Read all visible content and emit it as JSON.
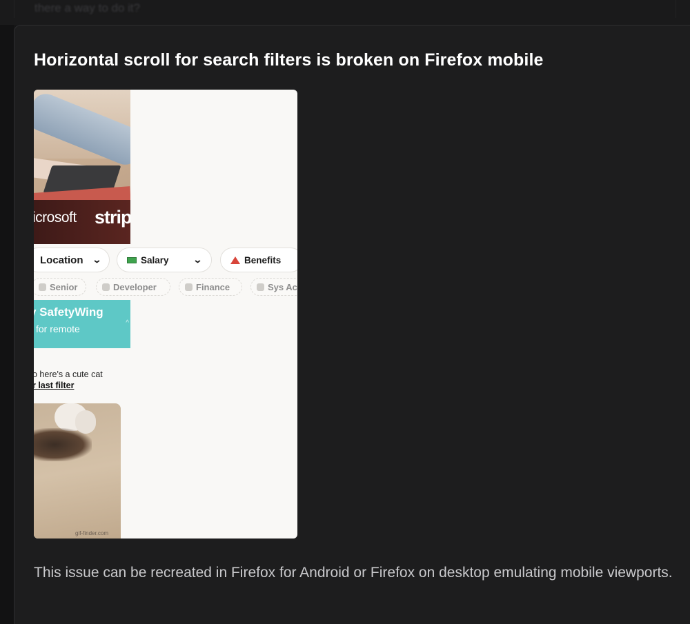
{
  "previous_card": {
    "snippet": "there a way to do it?"
  },
  "issue": {
    "title": "Horizontal scroll for search filters is broken on Firefox mobile",
    "description": "This issue can be recreated in Firefox for Android or Firefox on desktop emulating mobile viewports."
  },
  "screenshot": {
    "hero_logos": [
      "icrosoft",
      "strip"
    ],
    "filters": [
      {
        "label": "Location",
        "icon": "location-dot-icon"
      },
      {
        "label": "Salary",
        "icon": "money-icon"
      },
      {
        "label": "Benefits",
        "icon": "tent-icon"
      }
    ],
    "tags": [
      "Senior",
      "Developer",
      "Finance",
      "Sys Ac"
    ],
    "banner": {
      "title": "y SafetyWing",
      "subtitle": "for remote"
    },
    "cat_message": "o here's a cute cat",
    "cat_link": "r last filter",
    "cat_credit": "gif-finder.com"
  },
  "colors": {
    "background": "#161617",
    "card": "#1d1d1e",
    "banner": "#5ec8c6",
    "description_text": "#c9c9cc"
  }
}
